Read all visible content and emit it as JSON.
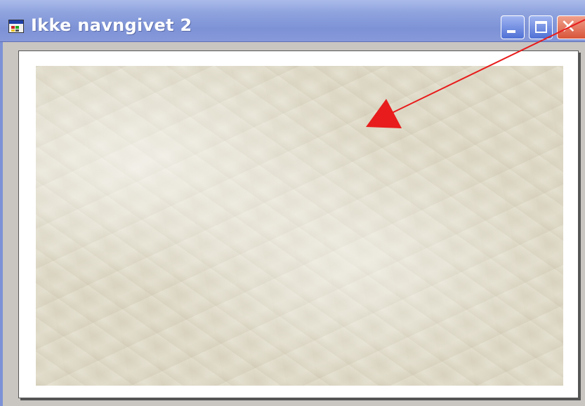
{
  "window": {
    "title": "Ikke navngivet 2",
    "icon": "image-document-icon",
    "controls": {
      "minimize_icon": "minimize-icon",
      "maximize_icon": "maximize-icon",
      "close_icon": "close-icon",
      "close_glyph": "✕"
    }
  },
  "canvas": {
    "texture": "crumpled-paper",
    "texture_color": "#e6e2d2"
  },
  "annotation": {
    "type": "arrow",
    "color": "#e81c1c"
  },
  "colors": {
    "titlebar": "#7d92d6",
    "close_button": "#d8553a",
    "window_bg": "#c9c6c2"
  }
}
